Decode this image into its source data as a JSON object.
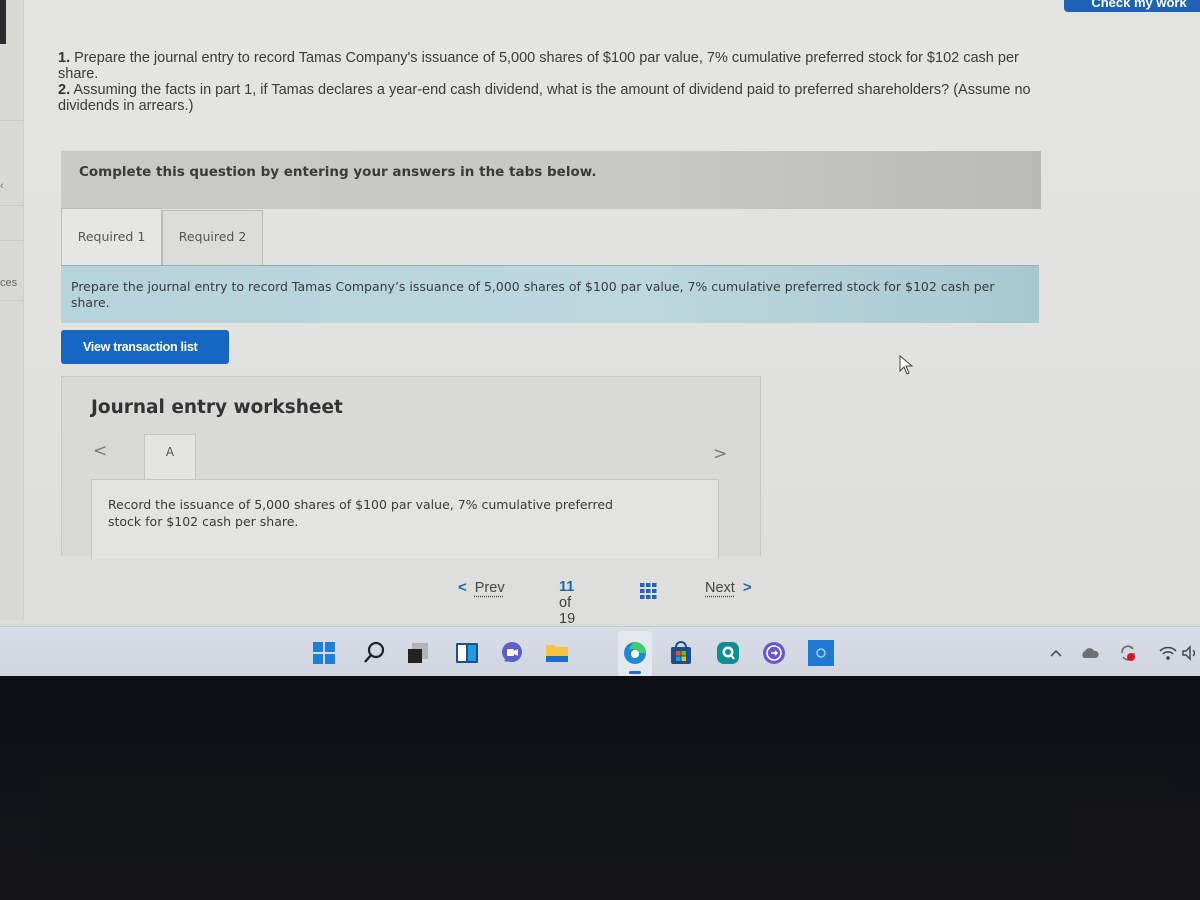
{
  "header": {
    "check_button_label": "Check my work"
  },
  "left_panel": {
    "fragment_label": "ces"
  },
  "question": {
    "part1_number": "1.",
    "part1_text": "Prepare the journal entry to record Tamas Company's issuance of 5,000 shares of $100 par value, 7% cumulative preferred stock for $102 cash per share.",
    "part2_number": "2.",
    "part2_text": "Assuming the facts in part 1, if Tamas declares a year-end cash dividend, what is the amount of dividend paid to preferred shareholders? (Assume no dividends in arrears.)"
  },
  "instructions": "Complete this question by entering your answers in the tabs below.",
  "tabs": [
    {
      "label": "Required 1",
      "active": true
    },
    {
      "label": "Required 2",
      "active": false
    }
  ],
  "required_prompt": "Prepare the journal entry to record Tamas Company’s issuance of 5,000 shares of $100 par value, 7% cumulative preferred stock for $102 cash per share.",
  "view_transaction_list_label": "View transaction list",
  "worksheet": {
    "title": "Journal entry worksheet",
    "prev_glyph": "<",
    "next_glyph": ">",
    "entry_tab_label": "A",
    "entry_description": "Record the issuance of 5,000 shares of $100 par value, 7% cumulative preferred stock for $102 cash per share."
  },
  "pagination": {
    "prev_label": "Prev",
    "next_label": "Next",
    "current": "11",
    "of_label": "of",
    "total": "19"
  },
  "taskbar": {
    "apps": [
      "start",
      "search",
      "task-view",
      "widgets",
      "teams-chat",
      "file-explorer",
      "edge",
      "microsoft-store",
      "app-search",
      "app-circle",
      "app-square"
    ],
    "active_app": "edge",
    "tray": [
      "show-hidden-icons",
      "onedrive",
      "sync-alert",
      "wifi",
      "volume"
    ]
  },
  "colors": {
    "accent_blue": "#1666c3",
    "banner_blue": "#b6d4dc",
    "instruction_gray": "#c9c9c6"
  }
}
